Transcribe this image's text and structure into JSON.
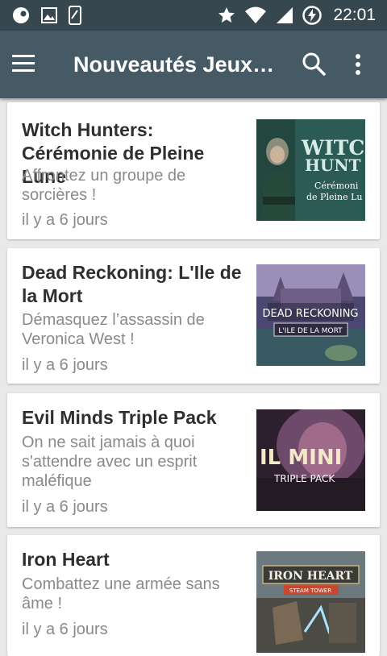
{
  "status_bar": {
    "time": "22:01",
    "left_icons": [
      "sync-icon",
      "image-icon",
      "phone-icon"
    ],
    "right_icons": [
      "star-icon",
      "wifi-icon",
      "signal-icon",
      "battery-charging-icon"
    ]
  },
  "toolbar": {
    "title": "Nouveautés Jeux…",
    "background": "#455a64",
    "status_background": "#37474f"
  },
  "games": [
    {
      "title": "Witch Hunters: Cérémonie de Pleine Lune",
      "description": "Affrontez un groupe de sorcières !",
      "date": "il y a 6 jours",
      "thumb_text": [
        "WITCH",
        "HUNT",
        "Cérémoni",
        "de Pleine Lu"
      ]
    },
    {
      "title": "Dead Reckoning: L'Ile de la Mort",
      "description": "Démasquez l’assassin de Veronica West !",
      "date": "il y a 6 jours",
      "thumb_text": [
        "DEAD RECKONING",
        "L'ILE DE LA MORT"
      ]
    },
    {
      "title": "Evil Minds Triple Pack",
      "description": "On ne sait jamais à quoi s'attendre avec un esprit maléfique",
      "date": "il y a 6 jours",
      "thumb_text": [
        "IL MINI",
        "TRIPLE PACK"
      ]
    },
    {
      "title": "Iron Heart",
      "description": "Combattez une armée sans âme !",
      "date": "il y a 6 jours",
      "thumb_text": [
        "IRON HEART",
        "STEAM TOWER"
      ]
    }
  ]
}
